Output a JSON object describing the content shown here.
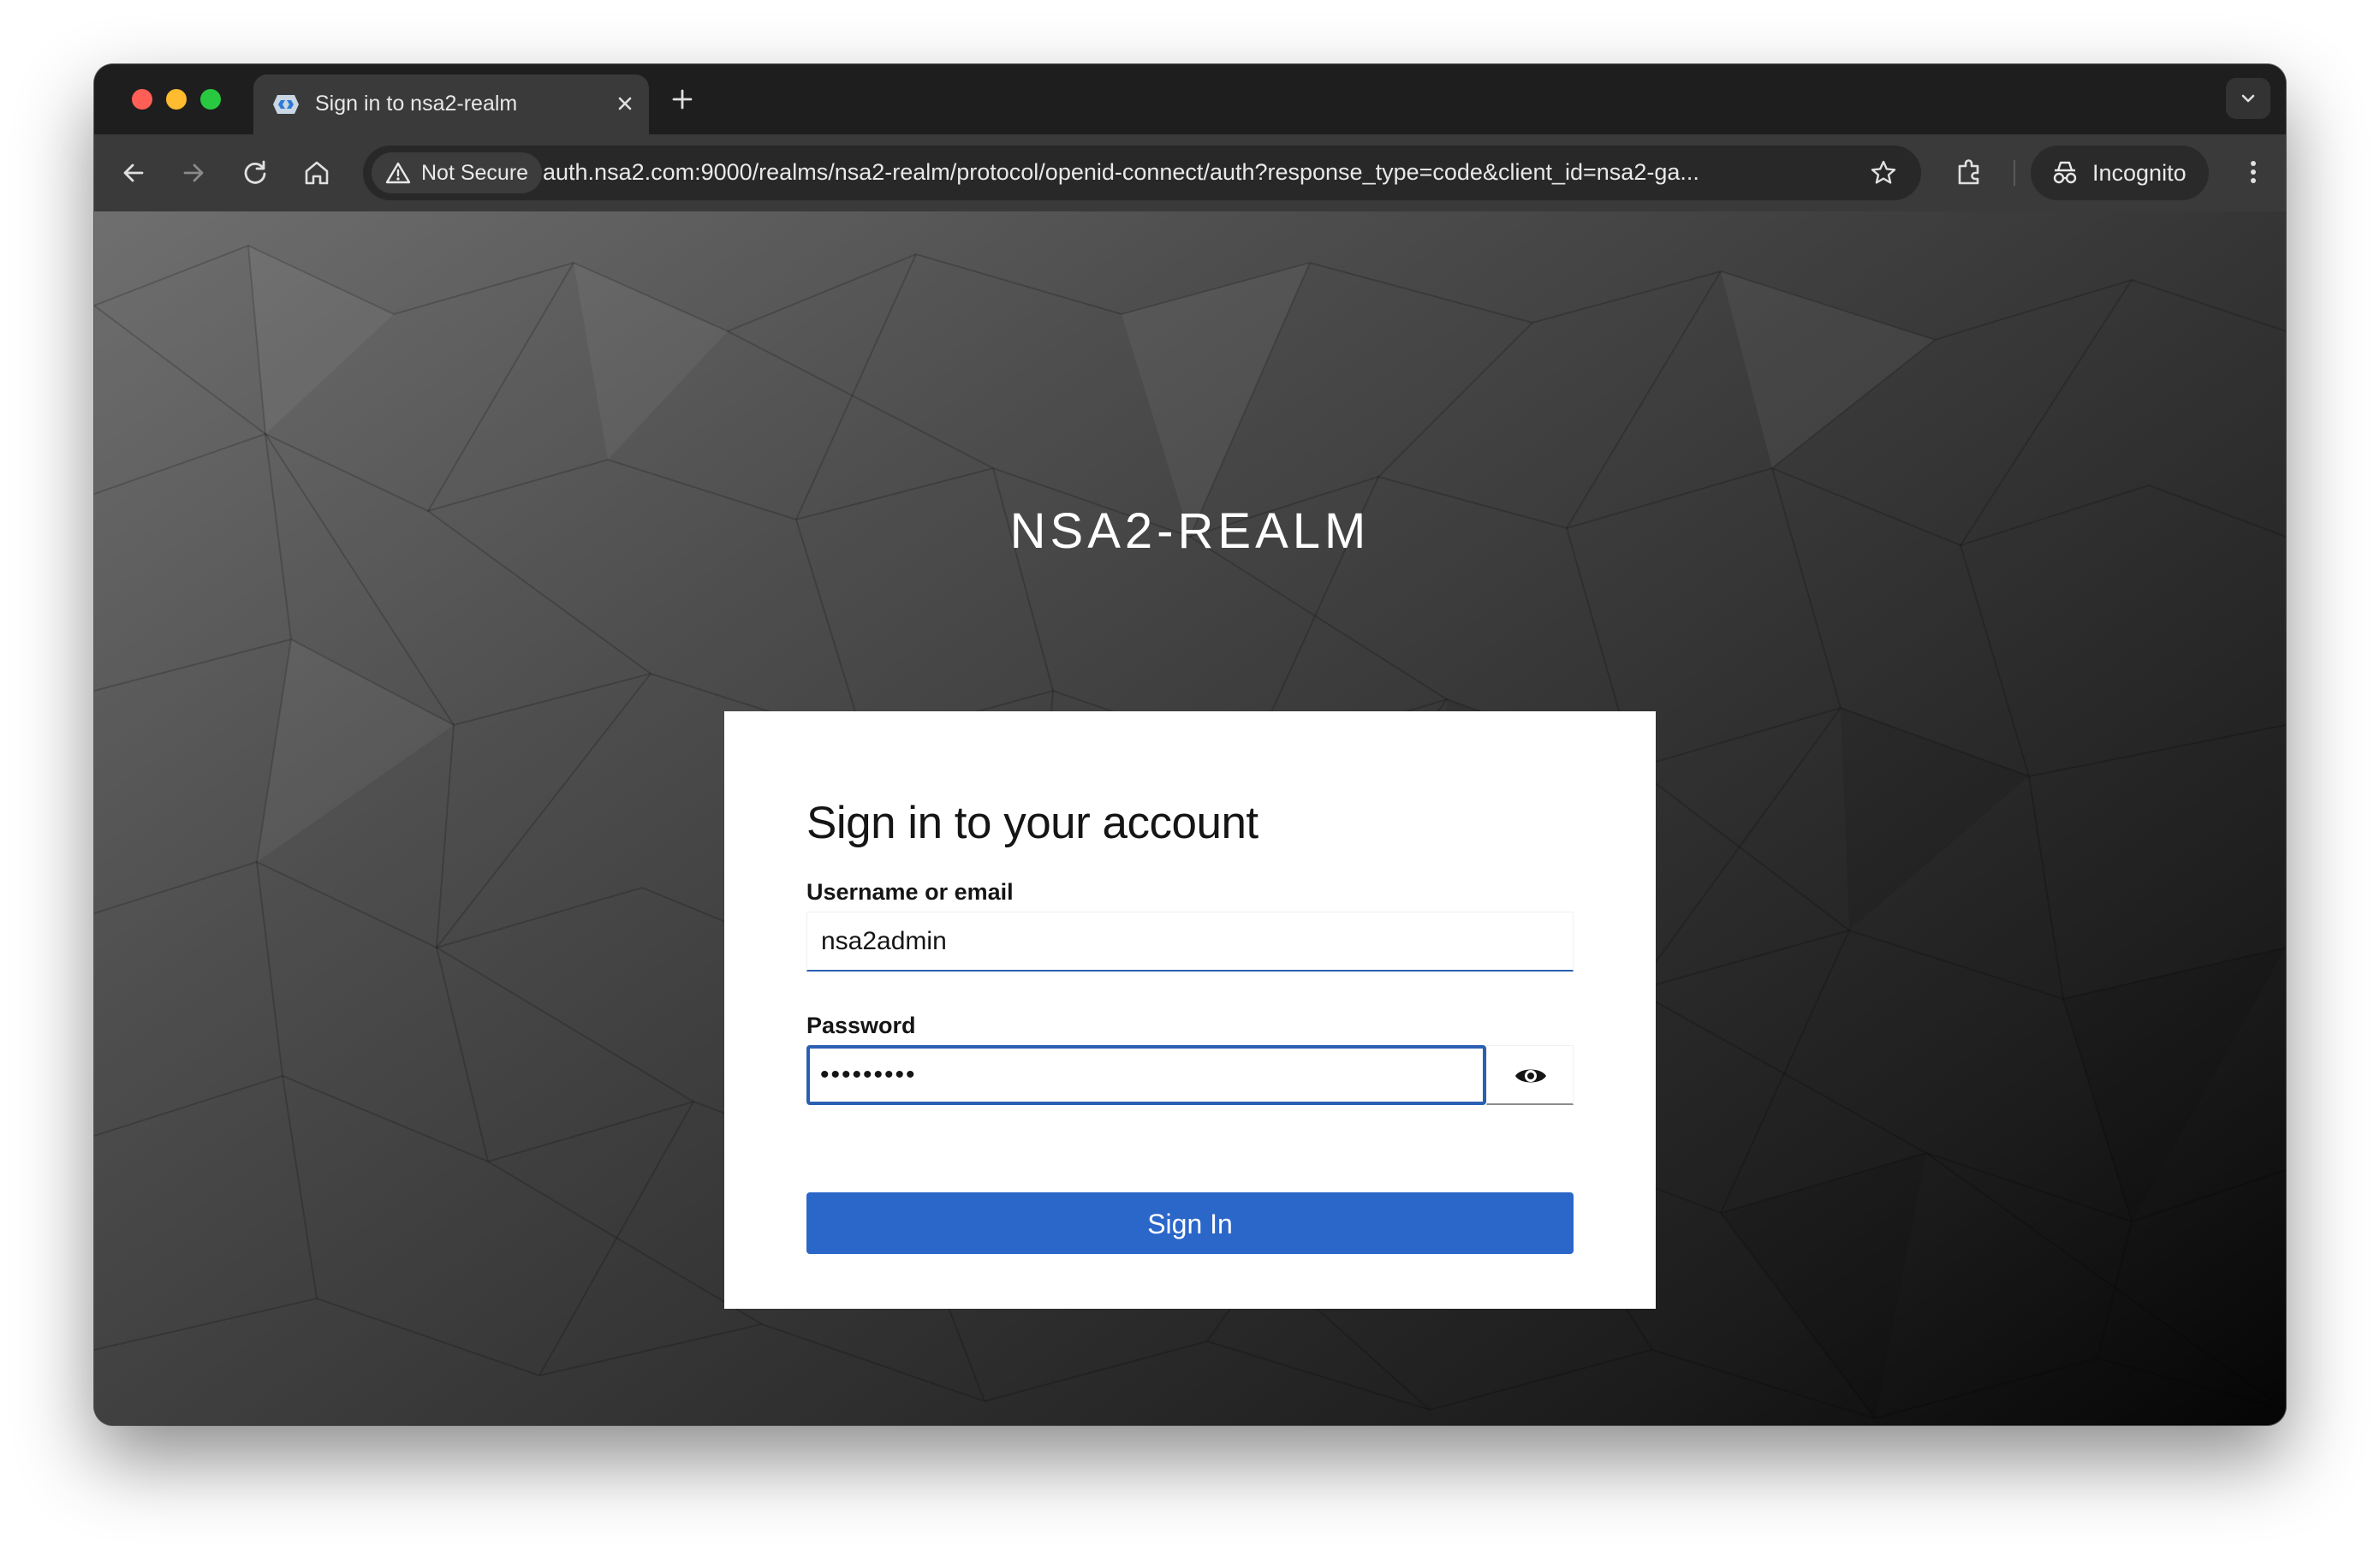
{
  "browser": {
    "tab": {
      "title": "Sign in to nsa2-realm",
      "favicon": "keycloak-icon"
    },
    "new_tab_icon": "plus-icon",
    "tab_menu_icon": "chevron-down-icon",
    "security_label": "Not Secure",
    "url": "auth.nsa2.com:9000/realms/nsa2-realm/protocol/openid-connect/auth?response_type=code&client_id=nsa2-ga...",
    "profile_label": "Incognito",
    "icons": [
      "back-icon",
      "forward-icon",
      "reload-icon",
      "home-icon",
      "warning-icon",
      "star-icon",
      "extensions-icon",
      "incognito-icon",
      "more-icon"
    ]
  },
  "page": {
    "realm_title": "NSA2-REALM",
    "heading": "Sign in to your account",
    "username": {
      "label": "Username or email",
      "value": "nsa2admin"
    },
    "password": {
      "label": "Password",
      "value": "•••••••••"
    },
    "show_password_icon": "eye-icon",
    "submit_label": "Sign In"
  },
  "colors": {
    "primary_button": "#2b66c9",
    "focus_border": "#2b5fb3",
    "card_background": "#ffffff",
    "browser_chrome": "#3a3a3a"
  }
}
